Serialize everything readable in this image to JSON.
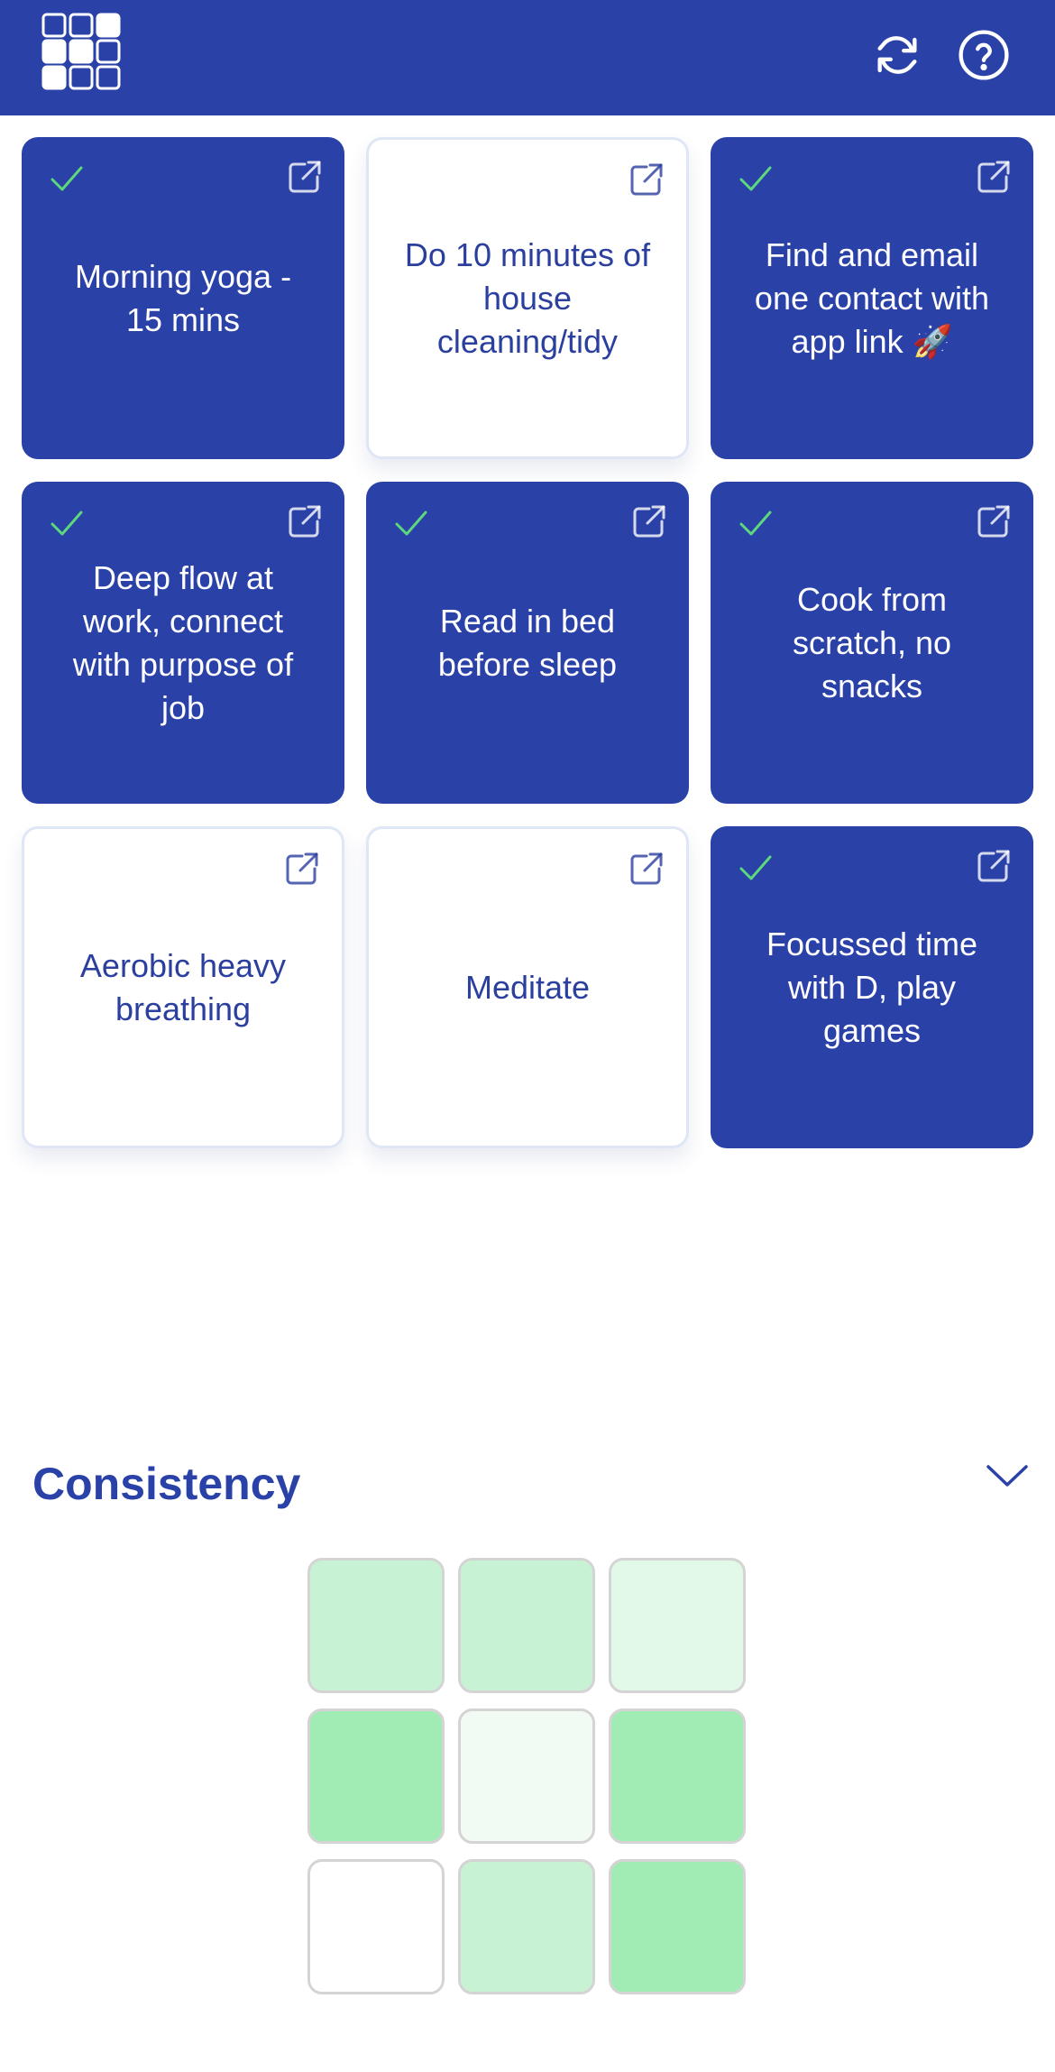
{
  "header": {
    "logo_icon": "grid-logo-icon",
    "refresh_icon": "refresh-icon",
    "help_icon": "help-circle-icon",
    "background": "#2a41a8"
  },
  "tasks": [
    {
      "label": "Morning yoga - 15 mins",
      "completed": true
    },
    {
      "label": "Do 10 minutes of house cleaning/tidy",
      "completed": false
    },
    {
      "label": "Find and email one contact with app link 🚀",
      "completed": true
    },
    {
      "label": "Deep flow at work, connect with purpose of job",
      "completed": true
    },
    {
      "label": "Read in bed before sleep",
      "completed": true
    },
    {
      "label": "Cook from scratch, no snacks",
      "completed": true
    },
    {
      "label": "Aerobic heavy breathing",
      "completed": false
    },
    {
      "label": "Meditate",
      "completed": false
    },
    {
      "label": "Focussed time with D, play games",
      "completed": true
    }
  ],
  "consistency": {
    "title": "Consistency",
    "toggle_icon": "chevron-down-icon",
    "cells": [
      {
        "color": "#c8f2d4"
      },
      {
        "color": "#c8f2d4"
      },
      {
        "color": "#e2f8e8"
      },
      {
        "color": "#a0ecb4"
      },
      {
        "color": "#f1fbf3"
      },
      {
        "color": "#a0ecb4"
      },
      {
        "color": "#ffffff"
      },
      {
        "color": "#c8f2d4"
      },
      {
        "color": "#a0ecb4"
      }
    ]
  },
  "colors": {
    "accent": "#2a41a8",
    "check": "#5dd87c",
    "card_text_light": "#ffffff",
    "card_text_dark": "#2a3f9e"
  }
}
